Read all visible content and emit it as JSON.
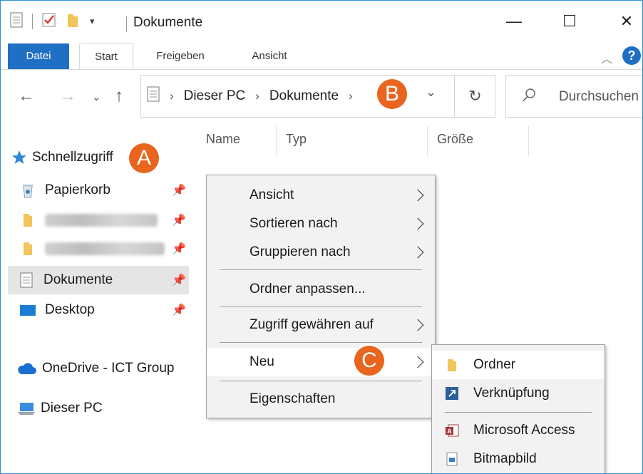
{
  "window": {
    "title": "Dokumente",
    "minimize": "—",
    "maximize": "☐",
    "close": "✕"
  },
  "ribbon": {
    "tabs": [
      "Datei",
      "Start",
      "Freigeben",
      "Ansicht"
    ],
    "help": "?"
  },
  "address": {
    "crumbs": [
      "Dieser PC",
      "Dokumente"
    ],
    "search_placeholder": "Durchsuchen"
  },
  "badges": {
    "a": "A",
    "b": "B",
    "c": "C"
  },
  "nav": {
    "quick_access": "Schnellzugriff",
    "items": [
      "Papierkorb",
      "Dokumente",
      "Desktop"
    ],
    "onedrive": "OneDrive - ICT Group",
    "this_pc": "Dieser PC"
  },
  "columns": [
    "Name",
    "Typ",
    "Größe"
  ],
  "context_menu": [
    "Ansicht",
    "Sortieren nach",
    "Gruppieren nach",
    "Ordner anpassen...",
    "Zugriff gewähren auf",
    "Neu",
    "Eigenschaften"
  ],
  "submenu": [
    "Ordner",
    "Verknüpfung",
    "Microsoft Access",
    "Bitmapbild"
  ],
  "colors": {
    "accent": "#1f6fc5",
    "badge": "#e8641f",
    "folder": "#f1c55b"
  }
}
